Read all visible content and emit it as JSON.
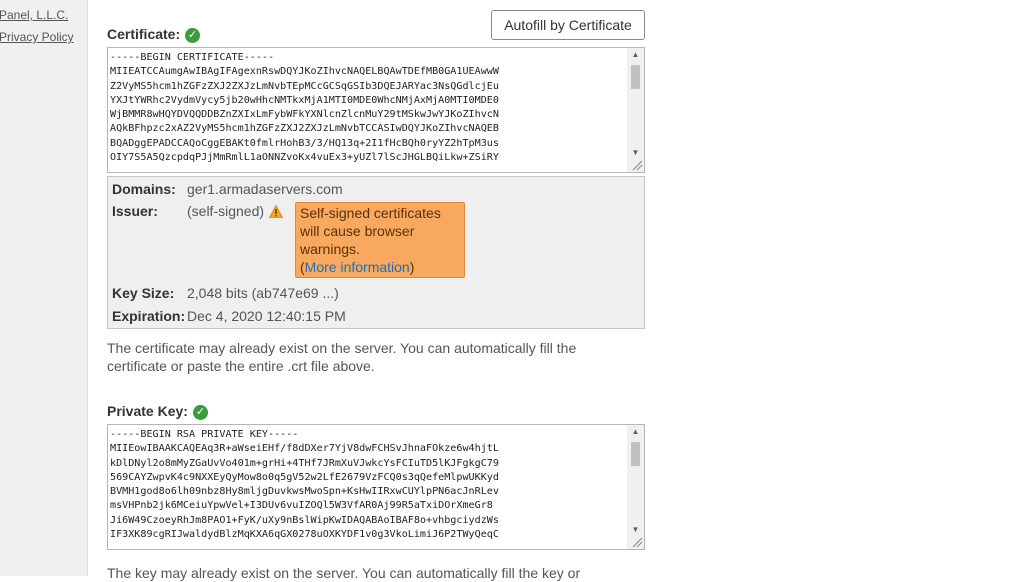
{
  "sidebar": {
    "link_1": "Panel, L.L.C.",
    "link_2": "Privacy Policy"
  },
  "certificate": {
    "label": "Certificate:",
    "autofill_label": "Autofill by Certificate",
    "text": "-----BEGIN CERTIFICATE-----\nMIIEATCCAumgAwIBAgIFAgexnRswDQYJKoZIhvcNAQELBQAwTDEfMB0GA1UEAwwW\nZ2VyMS5hcm1hZGFzZXJ2ZXJzLmNvbTEpMCcGCSqGSIb3DQEJARYac3NsQGdlcjEu\nYXJtYWRhc2VydmVycy5jb20wHhcNMTkxMjA1MTI0MDE0WhcNMjAxMjA0MTI0MDE0\nWjBMMR8wHQYDVQQDDBZnZXIxLmFybWFkYXNlcnZlcnMuY29tMSkwJwYJKoZIhvcN\nAQkBFhpzc2xAZ2VyMS5hcm1hZGFzZXJ2ZXJzLmNvbTCCASIwDQYJKoZIhvcNAQEB\nBQADggEPADCCAQoCggEBAKt0fmlrHohB3/3/HQ13q+2I1fHcBQh0ryYZ2hTpM3us\nOIY7S5A5QzcpdqPJjMmRmlL1aONNZvoKx4vuEx3+yUZl7lScJHGLBQiLkw+ZSiRY",
    "domains_label": "Domains:",
    "domains_value": "ger1.armadaservers.com",
    "issuer_label": "Issuer:",
    "issuer_value": "(self-signed)",
    "warning_text": "Self-signed certificates will cause browser warnings.",
    "more_info_open": "(",
    "more_info_link": "More information",
    "more_info_close": ")",
    "keysize_label": "Key Size:",
    "keysize_value": "2,048 bits (ab747e69 ...)",
    "expiration_label": "Expiration:",
    "expiration_value": "Dec 4, 2020 12:40:15 PM",
    "help": "The certificate may already exist on the server. You can automatically fill the certificate or paste the entire .crt file above."
  },
  "private_key": {
    "label": "Private Key:",
    "text": "-----BEGIN RSA PRIVATE KEY-----\nMIIEowIBAAKCAQEAq3R+aWseiEHf/f8dDXer7YjV8dwFCHSvJhnaFOkze6w4hjtL\nkDlDNyl2o8mMyZGaUvVo401m+grHi+4THf7JRmXuVJwkcYsFCIuTD5lKJFgkgC79\n569CAYZwpvK4c9NXXEyQyMow8o0q5gV52w2LfE2679VzFCQ0s3qQefeMlpwUKKyd\nBVMH1god8o6lh09nbz8Hy8mljgDuvkwsMwoSpn+KsHwIIRxwCUYlpPN6acJnRLev\nmsVHPnb2jk6MCeiuYpwVel+I3DUv6vuIZOQl5W3VfAR0Aj99R5aTxiDOrXmeGr8\nJi6W49CzoeyRhJm8PAO1+FyK/uXy9nBslWipKwIDAQABAoIBAF8o+vhbgciydzWs\nIF3XK89cgRIJwaldydBlzMqKXA6qGX0278uOXKYDF1v0g3VkoLimiJ6P2TWyQeqC",
    "help": "The key may already exist on the server. You can automatically fill the key or"
  },
  "colors": {
    "success_green": "#3c9b3c",
    "warning_orange": "#f9a860",
    "link_blue": "#1d70b8"
  }
}
